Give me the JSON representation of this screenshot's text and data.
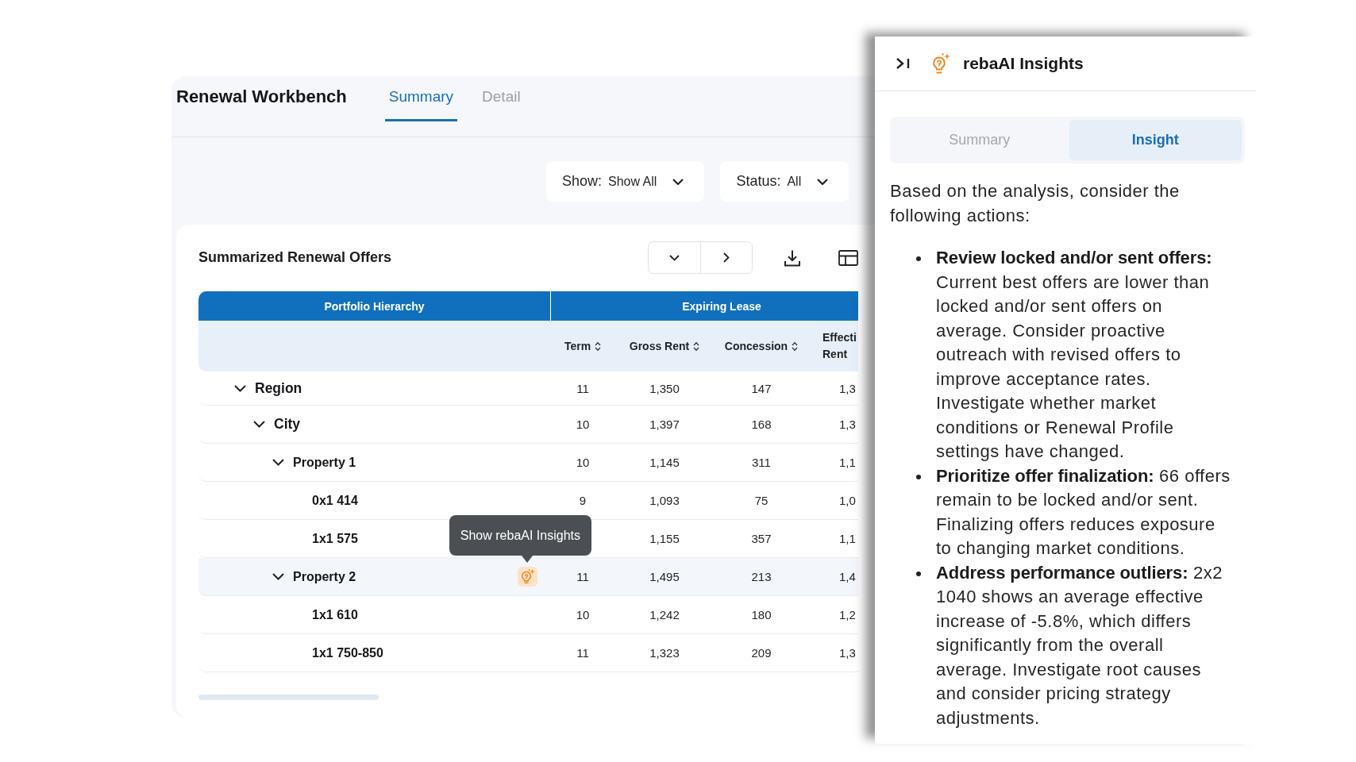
{
  "header": {
    "title": "Renewal Workbench",
    "tabs": [
      {
        "label": "Summary",
        "selected": true
      },
      {
        "label": "Detail",
        "selected": false
      }
    ]
  },
  "filters": [
    {
      "label": "Show:",
      "value": "Show All"
    },
    {
      "label": "Status:",
      "value": "All"
    }
  ],
  "offers": {
    "title": "Summarized Renewal Offers",
    "table": {
      "groups": [
        "Portfolio Hierarchy",
        "Expiring Lease"
      ],
      "columns": [
        {
          "label": "Term",
          "sortable": true
        },
        {
          "label": "Gross Rent",
          "sortable": true
        },
        {
          "label": "Concession",
          "sortable": true
        },
        {
          "label": "Effecti Rent",
          "sortable": false
        }
      ],
      "insight_tooltip": "Show rebaAI Insights",
      "rows": [
        {
          "name": "Region",
          "expanded": true,
          "hovered": false,
          "term": "11",
          "gross_rent": "1,350",
          "concession": "147",
          "effective_rent": "1,3",
          "children": [
            {
              "name": "City",
              "expanded": true,
              "hovered": false,
              "term": "10",
              "gross_rent": "1,397",
              "concession": "168",
              "effective_rent": "1,3",
              "children": [
                {
                  "name": "Property 1",
                  "expanded": true,
                  "hovered": false,
                  "term": "10",
                  "gross_rent": "1,145",
                  "concession": "311",
                  "effective_rent": "1,1",
                  "children": [
                    {
                      "name": "0x1 414",
                      "hovered": false,
                      "term": "9",
                      "gross_rent": "1,093",
                      "concession": "75",
                      "effective_rent": "1,0"
                    },
                    {
                      "name": "1x1 575",
                      "hovered": false,
                      "gross_rent": "1,155",
                      "concession": "357",
                      "effective_rent": "1,1"
                    }
                  ]
                },
                {
                  "name": "Property 2",
                  "expanded": true,
                  "hovered": true,
                  "term": "11",
                  "gross_rent": "1,495",
                  "concession": "213",
                  "effective_rent": "1,4",
                  "children": [
                    {
                      "name": "1x1 610",
                      "hovered": false,
                      "term": "10",
                      "gross_rent": "1,242",
                      "concession": "180",
                      "effective_rent": "1,2"
                    },
                    {
                      "name": "1x1 750-850",
                      "hovered": false,
                      "term": "11",
                      "gross_rent": "1,323",
                      "concession": "209",
                      "effective_rent": "1,3"
                    }
                  ]
                }
              ]
            }
          ]
        }
      ]
    }
  },
  "insights_panel": {
    "title": "rebaAI Insights",
    "tabs": [
      {
        "label": "Summary",
        "selected": false
      },
      {
        "label": "Insight",
        "selected": true
      }
    ],
    "intro": "Based on the analysis, consider the following actions:",
    "items": [
      "**Review locked and/or sent offers:** Current best offers are lower than locked and/or sent offers on average. Consider proactive outreach with revised offers to improve acceptance rates. Investigate whether market conditions or Renewal Profile settings have changed.",
      "**Prioritize offer finalization:** 66 offers remain to be locked and/or sent. Finalizing offers reduces exposure to changing market conditions.",
      "**Address performance outliers:** 2x2 1040 shows an average effective increase of -5.8%, which differs significantly from the overall average. Investigate root causes and consider pricing strategy adjustments."
    ]
  }
}
